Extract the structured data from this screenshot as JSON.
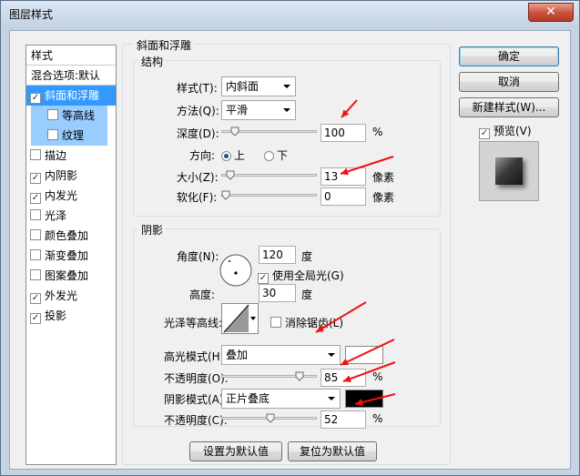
{
  "window": {
    "title": "图层样式",
    "close_glyph": "✕"
  },
  "style_list": {
    "header": "样式",
    "blend_default": "混合选项:默认",
    "items": [
      {
        "label": "斜面和浮雕",
        "checked": true,
        "selected": true
      },
      {
        "label": "等高线",
        "checked": false,
        "sub": true
      },
      {
        "label": "纹理",
        "checked": false,
        "sub": true
      },
      {
        "label": "描边",
        "checked": false
      },
      {
        "label": "内阴影",
        "checked": true
      },
      {
        "label": "内发光",
        "checked": true
      },
      {
        "label": "光泽",
        "checked": false
      },
      {
        "label": "颜色叠加",
        "checked": false
      },
      {
        "label": "渐变叠加",
        "checked": false
      },
      {
        "label": "图案叠加",
        "checked": false
      },
      {
        "label": "外发光",
        "checked": true
      },
      {
        "label": "投影",
        "checked": true
      }
    ]
  },
  "bevel": {
    "title": "斜面和浮雕",
    "structure": {
      "title": "结构",
      "style_label": "样式(T):",
      "style_value": "内斜面",
      "technique_label": "方法(Q):",
      "technique_value": "平滑",
      "depth_label": "深度(D):",
      "depth_value": "100",
      "depth_unit": "%",
      "depth_fraction": 0.1,
      "direction_label": "方向:",
      "direction_up": "上",
      "direction_down": "下",
      "size_label": "大小(Z):",
      "size_value": "13",
      "size_unit": "像素",
      "size_fraction": 0.05,
      "soften_label": "软化(F):",
      "soften_value": "0",
      "soften_unit": "像素",
      "soften_fraction": 0.0
    },
    "shading": {
      "title": "阴影",
      "angle_label": "角度(N):",
      "angle_value": "120",
      "angle_unit": "度",
      "global_light_label": "使用全局光(G)",
      "global_light_checked": true,
      "altitude_label": "高度:",
      "altitude_value": "30",
      "altitude_unit": "度",
      "gloss_contour_label": "光泽等高线:",
      "anti_alias_label": "消除锯齿(L)",
      "anti_alias_checked": false,
      "highlight_mode_label": "高光模式(H):",
      "highlight_mode_value": "叠加",
      "highlight_color": "#ffffff",
      "highlight_opacity_label": "不透明度(O):",
      "highlight_opacity_value": "85",
      "highlight_opacity_unit": "%",
      "highlight_opacity_fraction": 0.85,
      "shadow_mode_label": "阴影模式(A):",
      "shadow_mode_value": "正片叠底",
      "shadow_color": "#000000",
      "shadow_opacity_label": "不透明度(C):",
      "shadow_opacity_value": "52",
      "shadow_opacity_unit": "%",
      "shadow_opacity_fraction": 0.52
    },
    "make_default": "设置为默认值",
    "reset_default": "复位为默认值"
  },
  "buttons": {
    "ok": "确定",
    "cancel": "取消",
    "new_style": "新建样式(W)...",
    "preview_label": "预览(V)",
    "preview_checked": true
  },
  "colors": {
    "selection": "#3399ff",
    "annotation_arrow": "#ee1111"
  },
  "icons": {
    "check": "✓",
    "close": "close-icon",
    "arrow": "annotation-arrow-icon"
  }
}
